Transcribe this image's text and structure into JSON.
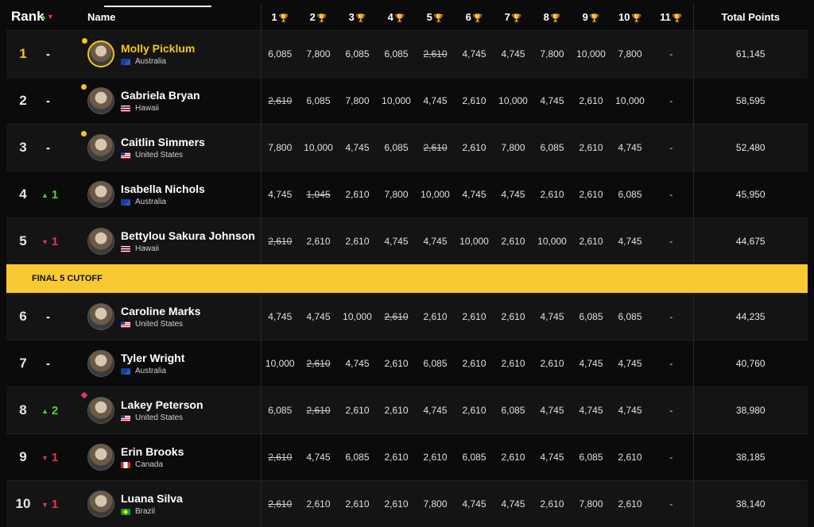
{
  "headers": {
    "rank": "Rank",
    "movement": "▲▼",
    "name": "Name",
    "events": [
      "1",
      "2",
      "3",
      "4",
      "5",
      "6",
      "7",
      "8",
      "9",
      "10",
      "11"
    ],
    "trophy_icon": "🏆",
    "total": "Total Points"
  },
  "cutoff_label": "FINAL 5 CUTOFF",
  "colors": {
    "accent_yellow": "#f5c518",
    "cutoff_band": "#f9c933",
    "up_green": "#4cd137",
    "down_red": "#e8374a",
    "background": "#0b0b0b"
  },
  "athletes": [
    {
      "rank": "1",
      "move": "-",
      "move_dir": "none",
      "name": "Molly Picklum",
      "country": "Australia",
      "flag": "au",
      "leader": true,
      "dot": true,
      "scores": [
        "6,085",
        "7,800",
        "6,085",
        "6,085",
        "2,610",
        "4,745",
        "4,745",
        "7,800",
        "10,000",
        "7,800",
        "-"
      ],
      "dropped": [
        4
      ],
      "total": "61,145"
    },
    {
      "rank": "2",
      "move": "-",
      "move_dir": "none",
      "name": "Gabriela Bryan",
      "country": "Hawaii",
      "flag": "hi",
      "leader": false,
      "dot": true,
      "scores": [
        "2,610",
        "6,085",
        "7,800",
        "10,000",
        "4,745",
        "2,610",
        "10,000",
        "4,745",
        "2,610",
        "10,000",
        "-"
      ],
      "dropped": [
        0
      ],
      "total": "58,595"
    },
    {
      "rank": "3",
      "move": "-",
      "move_dir": "none",
      "name": "Caitlin Simmers",
      "country": "United States",
      "flag": "us",
      "leader": false,
      "dot": true,
      "scores": [
        "7,800",
        "10,000",
        "4,745",
        "6,085",
        "2,610",
        "2,610",
        "7,800",
        "6,085",
        "2,610",
        "4,745",
        "-"
      ],
      "dropped": [
        4
      ],
      "total": "52,480"
    },
    {
      "rank": "4",
      "move": "1",
      "move_dir": "up",
      "name": "Isabella Nichols",
      "country": "Australia",
      "flag": "au",
      "leader": false,
      "dot": false,
      "scores": [
        "4,745",
        "1,045",
        "2,610",
        "7,800",
        "10,000",
        "4,745",
        "4,745",
        "2,610",
        "2,610",
        "6,085",
        "-"
      ],
      "dropped": [
        1
      ],
      "total": "45,950"
    },
    {
      "rank": "5",
      "move": "1",
      "move_dir": "down",
      "name": "Bettylou Sakura Johnson",
      "country": "Hawaii",
      "flag": "hi",
      "leader": false,
      "dot": false,
      "scores": [
        "2,610",
        "2,610",
        "2,610",
        "4,745",
        "4,745",
        "10,000",
        "2,610",
        "10,000",
        "2,610",
        "4,745",
        "-"
      ],
      "dropped": [
        0
      ],
      "total": "44,675"
    },
    {
      "rank": "6",
      "move": "-",
      "move_dir": "none",
      "name": "Caroline Marks",
      "country": "United States",
      "flag": "us",
      "leader": false,
      "dot": false,
      "scores": [
        "4,745",
        "4,745",
        "10,000",
        "2,610",
        "2,610",
        "2,610",
        "2,610",
        "4,745",
        "6,085",
        "6,085",
        "-"
      ],
      "dropped": [
        3
      ],
      "total": "44,235"
    },
    {
      "rank": "7",
      "move": "-",
      "move_dir": "none",
      "name": "Tyler Wright",
      "country": "Australia",
      "flag": "au",
      "leader": false,
      "dot": false,
      "scores": [
        "10,000",
        "2,610",
        "4,745",
        "2,610",
        "6,085",
        "2,610",
        "2,610",
        "2,610",
        "4,745",
        "4,745",
        "-"
      ],
      "dropped": [
        1
      ],
      "total": "40,760"
    },
    {
      "rank": "8",
      "move": "2",
      "move_dir": "up",
      "name": "Lakey Peterson",
      "country": "United States",
      "flag": "us",
      "leader": false,
      "dot": false,
      "diamond": true,
      "scores": [
        "6,085",
        "2,610",
        "2,610",
        "2,610",
        "4,745",
        "2,610",
        "6,085",
        "4,745",
        "4,745",
        "4,745",
        "-"
      ],
      "dropped": [
        1
      ],
      "total": "38,980"
    },
    {
      "rank": "9",
      "move": "1",
      "move_dir": "down",
      "name": "Erin Brooks",
      "country": "Canada",
      "flag": "ca",
      "leader": false,
      "dot": false,
      "scores": [
        "2,610",
        "4,745",
        "6,085",
        "2,610",
        "2,610",
        "6,085",
        "2,610",
        "4,745",
        "6,085",
        "2,610",
        "-"
      ],
      "dropped": [
        0
      ],
      "total": "38,185"
    },
    {
      "rank": "10",
      "move": "1",
      "move_dir": "down",
      "name": "Luana Silva",
      "country": "Brazil",
      "flag": "br",
      "leader": false,
      "dot": false,
      "scores": [
        "2,610",
        "2,610",
        "2,610",
        "2,610",
        "7,800",
        "4,745",
        "4,745",
        "2,610",
        "7,800",
        "2,610",
        "-"
      ],
      "dropped": [
        0
      ],
      "total": "38,140"
    }
  ]
}
